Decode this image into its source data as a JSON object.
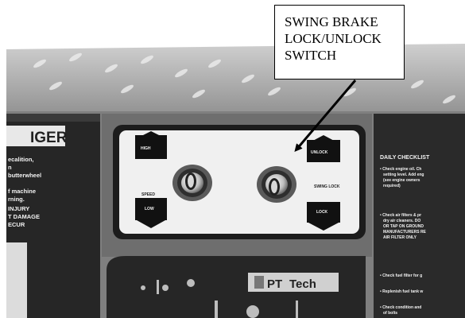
{
  "callout": {
    "line1": "SWING BRAKE",
    "line2": "LOCK/UNLOCK",
    "line3": "SWITCH"
  },
  "photo": {
    "left_panel": {
      "heading": "IGER",
      "lines": [
        "ecalition,",
        "n",
        "butterwheel",
        "f machine",
        "rning.",
        "INJURY",
        "T DAMAGE",
        "ECUR"
      ]
    },
    "switch_panel": {
      "left_label": "SPEED",
      "left_top_button": "HIGH",
      "left_bottom_button": "LOW",
      "right_label": "SWING LOCK",
      "right_top_button": "UNLOCK",
      "right_bottom_button": "LOCK"
    },
    "right_panel": {
      "heading": "DAILY CHECKLIST",
      "lines": [
        "• Check engine oil. Ch",
        "setting level. Add eng",
        "(see engine owners",
        "required)",
        "• Check air filters & pr",
        "dry air cleaners. DO",
        "OR TAP ON GROUND",
        "MANUFACTURERS RE",
        "AIR FILTER ONLY",
        "• Check fuel filter for g",
        "• Replenish fuel tank w",
        "• Check condition and",
        "of bolts"
      ]
    },
    "logo": {
      "left": "PT",
      "right": "Tech"
    }
  }
}
